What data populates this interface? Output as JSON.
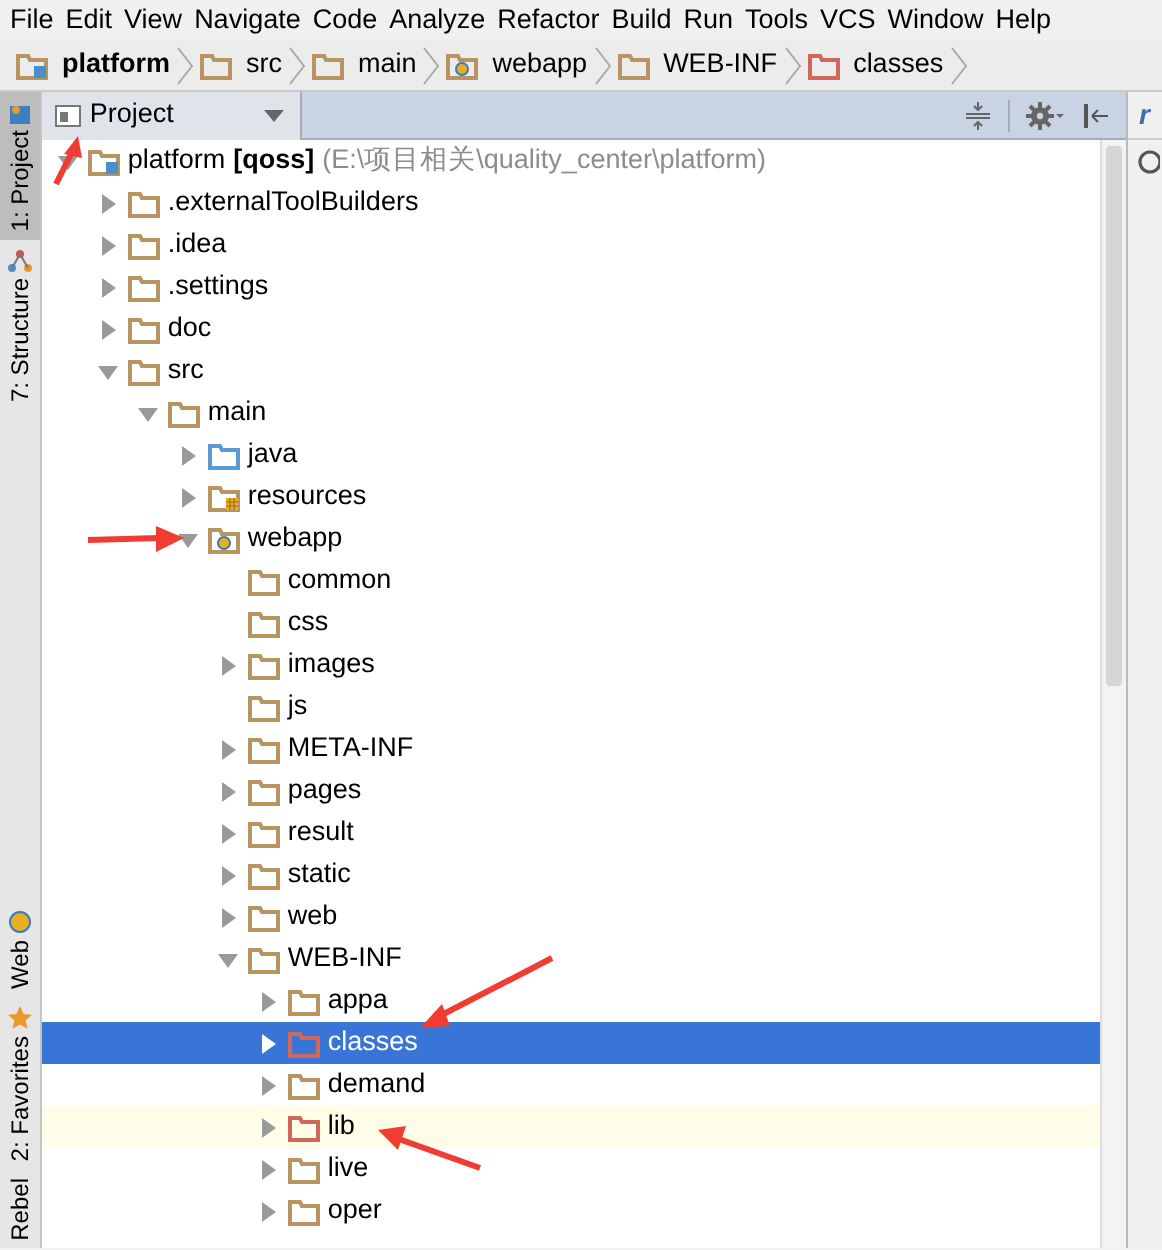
{
  "menu": [
    "File",
    "Edit",
    "View",
    "Navigate",
    "Code",
    "Analyze",
    "Refactor",
    "Build",
    "Run",
    "Tools",
    "VCS",
    "Window",
    "Help"
  ],
  "breadcrumb": [
    {
      "label": "platform",
      "kind": "module"
    },
    {
      "label": "src",
      "kind": "folder"
    },
    {
      "label": "main",
      "kind": "folder"
    },
    {
      "label": "webapp",
      "kind": "web-folder"
    },
    {
      "label": "WEB-INF",
      "kind": "folder"
    },
    {
      "label": "classes",
      "kind": "excluded-folder"
    }
  ],
  "side_tabs": [
    {
      "label": "1: Project",
      "selected": true,
      "kind": "project"
    },
    {
      "label": "7: Structure",
      "selected": false,
      "kind": "structure"
    },
    {
      "label": "Web",
      "selected": false,
      "kind": "web"
    },
    {
      "label": "2: Favorites",
      "selected": false,
      "kind": "favorites"
    },
    {
      "label": "Rebel",
      "selected": false,
      "kind": "none"
    }
  ],
  "panel": {
    "view": "Project",
    "right_tab": "r"
  },
  "tree": [
    {
      "label": "platform",
      "tag": "[qoss]",
      "path": "(E:\\项目相关\\quality_center\\platform)",
      "kind": "module",
      "expanded": true,
      "selected": false,
      "highlighted": false,
      "children": [
        {
          "label": ".externalToolBuilders",
          "kind": "folder",
          "expanded": false,
          "selected": false,
          "highlighted": false
        },
        {
          "label": ".idea",
          "kind": "folder",
          "expanded": false,
          "selected": false,
          "highlighted": false
        },
        {
          "label": ".settings",
          "kind": "folder",
          "expanded": false,
          "selected": false,
          "highlighted": false
        },
        {
          "label": "doc",
          "kind": "folder",
          "expanded": false,
          "selected": false,
          "highlighted": false
        },
        {
          "label": "src",
          "kind": "folder",
          "expanded": true,
          "selected": false,
          "highlighted": false,
          "children": [
            {
              "label": "main",
              "kind": "folder",
              "expanded": true,
              "selected": false,
              "highlighted": false,
              "children": [
                {
                  "label": "java",
                  "kind": "source-folder",
                  "expanded": false,
                  "selected": false,
                  "highlighted": false
                },
                {
                  "label": "resources",
                  "kind": "resource-folder",
                  "expanded": false,
                  "selected": false,
                  "highlighted": false
                },
                {
                  "label": "webapp",
                  "kind": "web-folder",
                  "expanded": true,
                  "selected": false,
                  "highlighted": false,
                  "children": [
                    {
                      "label": "common",
                      "kind": "folder",
                      "selected": false,
                      "highlighted": false
                    },
                    {
                      "label": "css",
                      "kind": "folder",
                      "selected": false,
                      "highlighted": false
                    },
                    {
                      "label": "images",
                      "kind": "folder",
                      "expanded": false,
                      "selected": false,
                      "highlighted": false
                    },
                    {
                      "label": "js",
                      "kind": "folder",
                      "selected": false,
                      "highlighted": false
                    },
                    {
                      "label": "META-INF",
                      "kind": "folder",
                      "expanded": false,
                      "selected": false,
                      "highlighted": false
                    },
                    {
                      "label": "pages",
                      "kind": "folder",
                      "expanded": false,
                      "selected": false,
                      "highlighted": false
                    },
                    {
                      "label": "result",
                      "kind": "folder",
                      "expanded": false,
                      "selected": false,
                      "highlighted": false
                    },
                    {
                      "label": "static",
                      "kind": "folder",
                      "expanded": false,
                      "selected": false,
                      "highlighted": false
                    },
                    {
                      "label": "web",
                      "kind": "folder",
                      "expanded": false,
                      "selected": false,
                      "highlighted": false
                    },
                    {
                      "label": "WEB-INF",
                      "kind": "folder",
                      "expanded": true,
                      "selected": false,
                      "highlighted": false,
                      "children": [
                        {
                          "label": "appa",
                          "kind": "folder",
                          "expanded": false,
                          "selected": false,
                          "highlighted": false
                        },
                        {
                          "label": "classes",
                          "kind": "excluded-folder",
                          "expanded": false,
                          "selected": true,
                          "highlighted": false
                        },
                        {
                          "label": "demand",
                          "kind": "folder",
                          "expanded": false,
                          "selected": false,
                          "highlighted": false
                        },
                        {
                          "label": "lib",
                          "kind": "excluded-folder",
                          "expanded": false,
                          "selected": false,
                          "highlighted": true
                        },
                        {
                          "label": "live",
                          "kind": "folder",
                          "expanded": false,
                          "selected": false,
                          "highlighted": false
                        },
                        {
                          "label": "oper",
                          "kind": "folder",
                          "expanded": false,
                          "selected": false,
                          "highlighted": false
                        }
                      ]
                    }
                  ]
                }
              ]
            }
          ]
        }
      ]
    }
  ]
}
